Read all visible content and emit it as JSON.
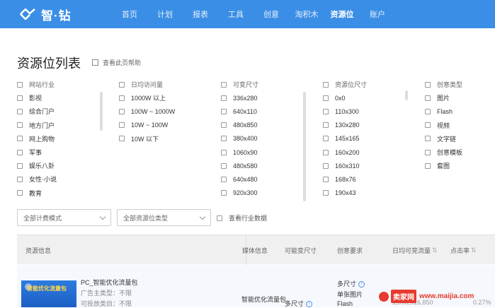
{
  "nav": {
    "logo_text": "智·钻",
    "items": [
      "首页",
      "计划",
      "报表",
      "工具",
      "创意",
      "淘积木",
      "资源位",
      "账户"
    ],
    "active_index": 6
  },
  "page": {
    "title": "资源位列表",
    "help": "查看此页帮助"
  },
  "filters": {
    "industry": {
      "header": "网站行业",
      "options": [
        "影视",
        "综合门户",
        "地方门户",
        "网上购物",
        "军事",
        "娱乐八卦",
        "女性·小说",
        "教育"
      ]
    },
    "traffic": {
      "header": "日均访问量",
      "options": [
        "1000W 以上",
        "100W ~ 1000W",
        "10W ~ 100W",
        "10W 以下"
      ]
    },
    "variable_size": {
      "header": "可变尺寸",
      "options": [
        "336x280",
        "640x110",
        "480x850",
        "380x400",
        "1060x90",
        "480x580",
        "640x480",
        "920x300"
      ]
    },
    "slot_size": {
      "header": "资源位尺寸",
      "options": [
        "0x0",
        "110x300",
        "130x280",
        "145x165",
        "160x200",
        "160x310",
        "168x76",
        "190x43"
      ]
    },
    "creative_type": {
      "header": "创意类型",
      "options": [
        "图片",
        "Flash",
        "视频",
        "文字链",
        "创意模板",
        "套图"
      ]
    }
  },
  "selects": {
    "plan_mode": "全部计费模式",
    "resource_type": "全部资源位类型",
    "industry_data": "查看行业数据"
  },
  "table": {
    "headers": {
      "resource": "资源信息",
      "media": "媒体信息",
      "variable": "可能变尺寸",
      "creative_req": "创意要求",
      "daily_traffic": "日均可竞流量",
      "ctr": "点击率"
    },
    "sort_mark": "⇅",
    "row": {
      "thumb_text": "智能优化流量包",
      "name": "PC_智能优化流量包",
      "advertiser": "广告主类型：不限",
      "category": "可投放类目：不限",
      "media": "智能优化流量包",
      "variable": "多尺寸",
      "creative_lines": [
        "多尺寸",
        "单张图片",
        "Flash"
      ],
      "traffic": "1,098,916,850",
      "ctr": "0.27%"
    }
  },
  "watermark": {
    "badge": "卖家网",
    "url": "www.maijia.com"
  }
}
